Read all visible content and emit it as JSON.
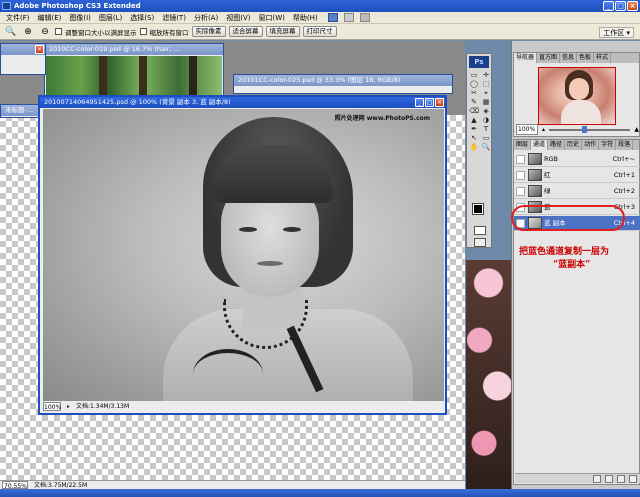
{
  "app": {
    "title": "Adobe Photoshop CS3 Extended"
  },
  "menu": [
    "文件(F)",
    "编辑(E)",
    "图像(I)",
    "图层(L)",
    "选择(S)",
    "滤镜(T)",
    "分析(A)",
    "视图(V)",
    "窗口(W)",
    "帮助(H)"
  ],
  "options": {
    "check1_label": "调整窗口大小以满屏显示",
    "check2_label": "缩放所有窗口",
    "btn_actual": "实际像素",
    "btn_fit": "适合屏幕",
    "btn_fill": "填充屏幕",
    "btn_print": "打印尺寸",
    "workspace": "工作区"
  },
  "docs": {
    "back1_title": "2010CC-color-019.psd @ 16.7% (hair, ...",
    "back2_title": "未标题-...",
    "back3_title": "20101CC-color-025.psd @ 33.3% (图层 18, RGB/8)",
    "main_title": "20100714064951425.psd @ 100% (背景 副本 3, 蓝 副本/8)",
    "main_zoom": "100%",
    "main_doc_size": "文档:1.34M/3.13M",
    "watermark": "照片处理网 www.PhotoPS.com"
  },
  "status": {
    "zoom": "70.55%",
    "doc_size": "文档:3.75M/22.5M"
  },
  "toolbox": {
    "logo": "Ps",
    "tools": [
      "▭",
      "✛",
      "◯",
      "⬚",
      "✂",
      "⌖",
      "✎",
      "▦",
      "⌫",
      "◈",
      "▲",
      "◑",
      "✒",
      "T",
      "↖",
      "▭",
      "✋",
      "🔍"
    ]
  },
  "navigator": {
    "tabs": [
      "导航器",
      "直方图",
      "信息",
      "色板",
      "样式"
    ],
    "zoom": "100%"
  },
  "channels": {
    "tabs": [
      "图层",
      "通道",
      "路径",
      "历史",
      "动作",
      "字符",
      "段落"
    ],
    "rows": [
      {
        "name": "RGB",
        "key": "Ctrl+~"
      },
      {
        "name": "红",
        "key": "Ctrl+1"
      },
      {
        "name": "绿",
        "key": "Ctrl+2"
      },
      {
        "name": "蓝",
        "key": "Ctrl+3"
      },
      {
        "name": "蓝 副本",
        "key": "Ctrl+4"
      }
    ]
  },
  "annotation": {
    "line1": "把蓝色通道复制一层为",
    "line2": "“蓝副本”"
  },
  "colors": {
    "titlebar": "#1f4fbd",
    "selected_row": "#4b72c4",
    "annotation": "#cc0000"
  }
}
